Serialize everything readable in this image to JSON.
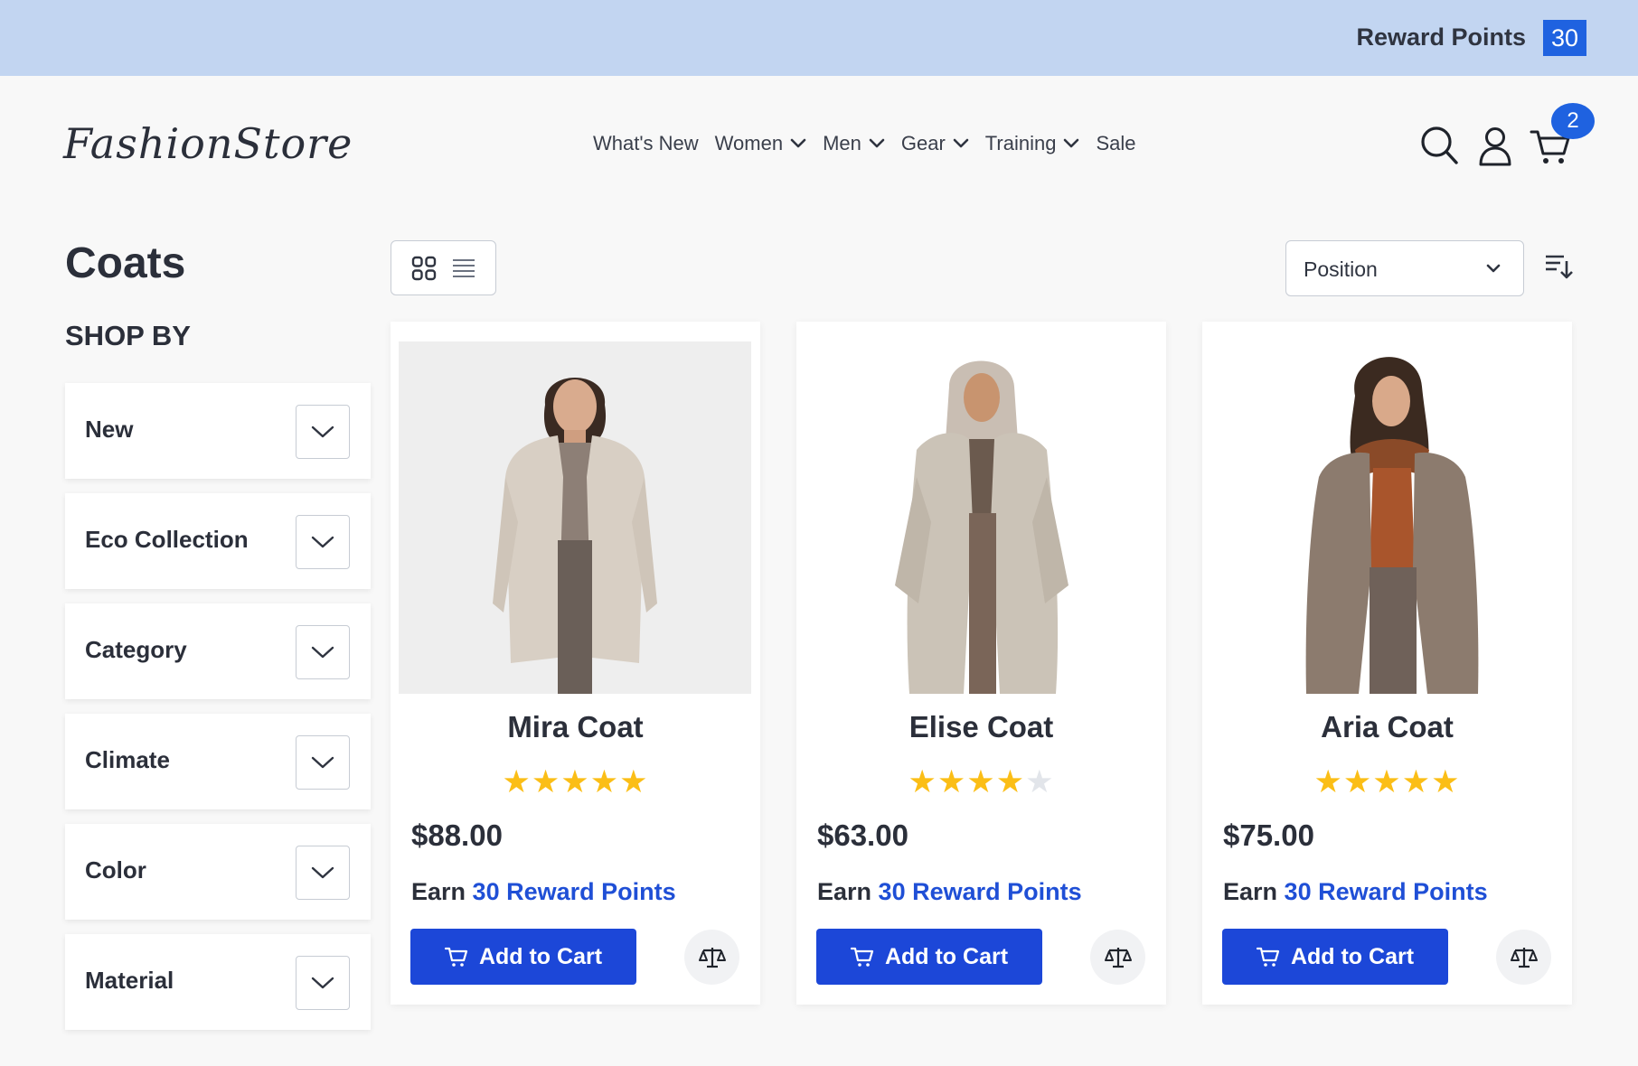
{
  "reward_bar": {
    "label": "Reward Points",
    "count": "30"
  },
  "header": {
    "logo": "FashionStore",
    "nav": [
      {
        "label": "What's New",
        "has_dropdown": false
      },
      {
        "label": "Women",
        "has_dropdown": true
      },
      {
        "label": "Men",
        "has_dropdown": true
      },
      {
        "label": "Gear",
        "has_dropdown": true
      },
      {
        "label": "Training",
        "has_dropdown": true
      },
      {
        "label": "Sale",
        "has_dropdown": false
      }
    ],
    "icons": [
      "search-icon",
      "account-icon",
      "cart-icon"
    ],
    "cart_count": "2"
  },
  "page": {
    "title": "Coats",
    "shop_by": "SHOP BY"
  },
  "filters": [
    {
      "label": "New"
    },
    {
      "label": "Eco Collection"
    },
    {
      "label": "Category"
    },
    {
      "label": "Climate"
    },
    {
      "label": "Color"
    },
    {
      "label": "Material"
    }
  ],
  "toolbar": {
    "sort_value": "Position",
    "view_mode": "grid"
  },
  "products": [
    {
      "name": "Mira Coat",
      "rating": 5,
      "price": "$88.00",
      "earn_prefix": "Earn",
      "earn_points": "30 Reward Points",
      "add_label": "Add to Cart"
    },
    {
      "name": "Elise Coat",
      "rating": 4,
      "price": "$63.00",
      "earn_prefix": "Earn",
      "earn_points": "30 Reward Points",
      "add_label": "Add to Cart"
    },
    {
      "name": "Aria Coat",
      "rating": 5,
      "price": "$75.00",
      "earn_prefix": "Earn",
      "earn_points": "30 Reward Points",
      "add_label": "Add to Cart"
    }
  ],
  "colors": {
    "reward_bar_bg": "#c2d5f1",
    "accent_blue": "#1f62e0",
    "button_blue": "#1c47d8",
    "link_blue": "#1f4fd6",
    "star_gold": "#fbbe16"
  }
}
